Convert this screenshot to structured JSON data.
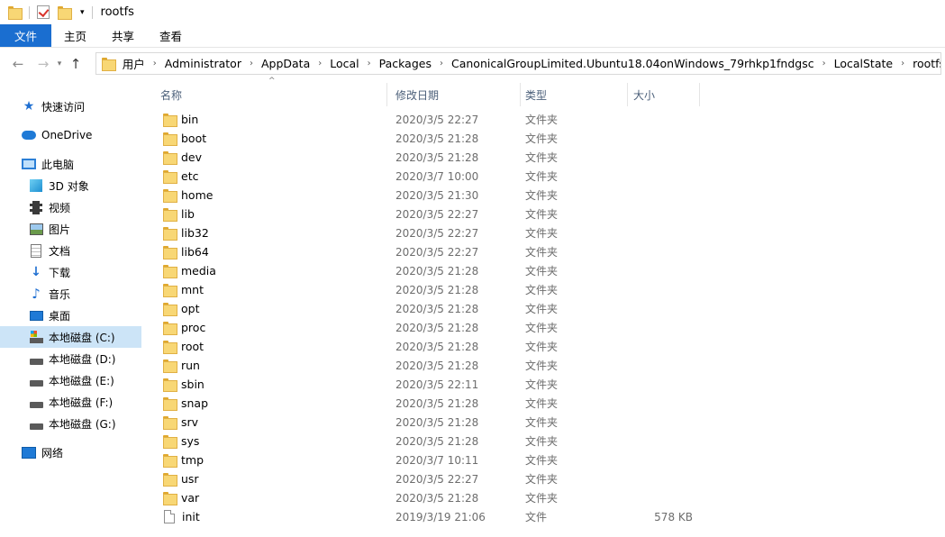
{
  "window": {
    "title": "rootfs"
  },
  "ribbon": {
    "tabs": [
      {
        "label": "文件"
      },
      {
        "label": "主页"
      },
      {
        "label": "共享"
      },
      {
        "label": "查看"
      }
    ]
  },
  "address": {
    "lead": "«",
    "crumbs": [
      "用户",
      "Administrator",
      "AppData",
      "Local",
      "Packages",
      "CanonicalGroupLimited.Ubuntu18.04onWindows_79rhkp1fndgsc",
      "LocalState",
      "rootfs"
    ]
  },
  "sidebar": {
    "quick_access": "快速访问",
    "onedrive": "OneDrive",
    "this_pc": "此电脑",
    "items": [
      {
        "label": "3D 对象",
        "icon": "cube-icon"
      },
      {
        "label": "视频",
        "icon": "video-icon"
      },
      {
        "label": "图片",
        "icon": "pictures-icon"
      },
      {
        "label": "文档",
        "icon": "documents-icon"
      },
      {
        "label": "下载",
        "icon": "download-icon"
      },
      {
        "label": "音乐",
        "icon": "music-icon"
      },
      {
        "label": "桌面",
        "icon": "desktop-icon"
      }
    ],
    "drives": [
      {
        "label": "本地磁盘 (C:)",
        "selected": true
      },
      {
        "label": "本地磁盘 (D:)",
        "selected": false
      },
      {
        "label": "本地磁盘 (E:)",
        "selected": false
      },
      {
        "label": "本地磁盘 (F:)",
        "selected": false
      },
      {
        "label": "本地磁盘 (G:)",
        "selected": false
      }
    ],
    "network": "网络"
  },
  "columns": {
    "name": "名称",
    "date": "修改日期",
    "type": "类型",
    "size": "大小"
  },
  "files": [
    {
      "name": "bin",
      "date": "2020/3/5 22:27",
      "type": "文件夹",
      "size": "",
      "kind": "folder"
    },
    {
      "name": "boot",
      "date": "2020/3/5 21:28",
      "type": "文件夹",
      "size": "",
      "kind": "folder"
    },
    {
      "name": "dev",
      "date": "2020/3/5 21:28",
      "type": "文件夹",
      "size": "",
      "kind": "folder"
    },
    {
      "name": "etc",
      "date": "2020/3/7 10:00",
      "type": "文件夹",
      "size": "",
      "kind": "folder"
    },
    {
      "name": "home",
      "date": "2020/3/5 21:30",
      "type": "文件夹",
      "size": "",
      "kind": "folder"
    },
    {
      "name": "lib",
      "date": "2020/3/5 22:27",
      "type": "文件夹",
      "size": "",
      "kind": "folder"
    },
    {
      "name": "lib32",
      "date": "2020/3/5 22:27",
      "type": "文件夹",
      "size": "",
      "kind": "folder"
    },
    {
      "name": "lib64",
      "date": "2020/3/5 22:27",
      "type": "文件夹",
      "size": "",
      "kind": "folder"
    },
    {
      "name": "media",
      "date": "2020/3/5 21:28",
      "type": "文件夹",
      "size": "",
      "kind": "folder"
    },
    {
      "name": "mnt",
      "date": "2020/3/5 21:28",
      "type": "文件夹",
      "size": "",
      "kind": "folder"
    },
    {
      "name": "opt",
      "date": "2020/3/5 21:28",
      "type": "文件夹",
      "size": "",
      "kind": "folder"
    },
    {
      "name": "proc",
      "date": "2020/3/5 21:28",
      "type": "文件夹",
      "size": "",
      "kind": "folder"
    },
    {
      "name": "root",
      "date": "2020/3/5 21:28",
      "type": "文件夹",
      "size": "",
      "kind": "folder"
    },
    {
      "name": "run",
      "date": "2020/3/5 21:28",
      "type": "文件夹",
      "size": "",
      "kind": "folder"
    },
    {
      "name": "sbin",
      "date": "2020/3/5 22:11",
      "type": "文件夹",
      "size": "",
      "kind": "folder"
    },
    {
      "name": "snap",
      "date": "2020/3/5 21:28",
      "type": "文件夹",
      "size": "",
      "kind": "folder"
    },
    {
      "name": "srv",
      "date": "2020/3/5 21:28",
      "type": "文件夹",
      "size": "",
      "kind": "folder"
    },
    {
      "name": "sys",
      "date": "2020/3/5 21:28",
      "type": "文件夹",
      "size": "",
      "kind": "folder"
    },
    {
      "name": "tmp",
      "date": "2020/3/7 10:11",
      "type": "文件夹",
      "size": "",
      "kind": "folder"
    },
    {
      "name": "usr",
      "date": "2020/3/5 22:27",
      "type": "文件夹",
      "size": "",
      "kind": "folder"
    },
    {
      "name": "var",
      "date": "2020/3/5 21:28",
      "type": "文件夹",
      "size": "",
      "kind": "folder"
    },
    {
      "name": "init",
      "date": "2019/3/19 21:06",
      "type": "文件",
      "size": "578 KB",
      "kind": "file"
    }
  ]
}
